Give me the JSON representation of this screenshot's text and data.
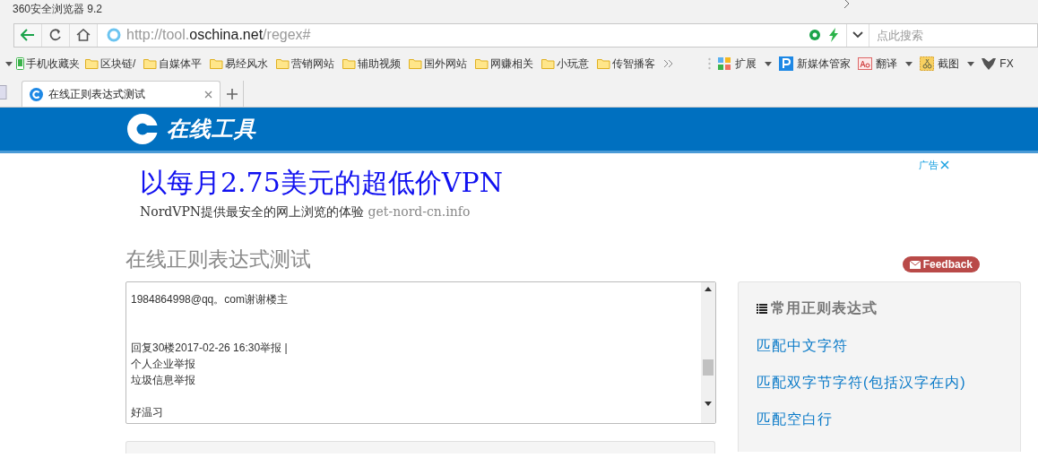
{
  "window": {
    "title": "360安全浏览器 9.2"
  },
  "address_bar": {
    "url_muted_start": "http://tool.",
    "url_domain": "oschina.net",
    "url_muted_end": "/regex#",
    "search_placeholder": "点此搜索"
  },
  "bookmarks": [
    {
      "label": "手机收藏夹",
      "kind": "phone"
    },
    {
      "label": "区块链/",
      "kind": "folder"
    },
    {
      "label": "自媒体平",
      "kind": "folder"
    },
    {
      "label": "易经风水",
      "kind": "folder"
    },
    {
      "label": "营销网站",
      "kind": "folder"
    },
    {
      "label": "辅助视频",
      "kind": "folder"
    },
    {
      "label": "国外网站",
      "kind": "folder"
    },
    {
      "label": "网赚相关",
      "kind": "folder"
    },
    {
      "label": "小玩意",
      "kind": "folder"
    },
    {
      "label": "传智播客",
      "kind": "folder"
    }
  ],
  "extensions": [
    {
      "label": "扩展",
      "kind": "grid",
      "dropdown": true
    },
    {
      "label": "新媒体管家",
      "kind": "p",
      "dropdown": false
    },
    {
      "label": "翻译",
      "kind": "aa",
      "dropdown": true
    },
    {
      "label": "截图",
      "kind": "scissors",
      "dropdown": true
    },
    {
      "label": "FX",
      "kind": "fox",
      "dropdown": false
    }
  ],
  "tabs": [
    {
      "label": "在线正则表达式测试",
      "selected": true
    }
  ],
  "site": {
    "logo_text": "在线工具"
  },
  "ad": {
    "label": "广告",
    "headline": "以每月2.75美元的超低价VPN",
    "text": "NordVPN提供最安全的网上浏览的体验",
    "domain": "get-nord-cn.info"
  },
  "page_title": "在线正则表达式测试",
  "feedback": "Feedback",
  "textarea": {
    "paragraphs": [
      {
        "lines": [
          "1984864998@qq。com谢谢楼主"
        ],
        "kind": "wide"
      },
      {
        "lines": [
          "回复30楼2017-02-26 16:30举报 |",
          "个人企业举报",
          "垃圾信息举报"
        ],
        "kind": "narrow"
      },
      {
        "lines": [
          "好温习"
        ],
        "kind": "last"
      }
    ]
  },
  "sidebar": {
    "title": "常用正则表达式",
    "items": [
      "匹配中文字符",
      "匹配双字节字符(包括汉字在内)",
      "匹配空白行"
    ]
  }
}
